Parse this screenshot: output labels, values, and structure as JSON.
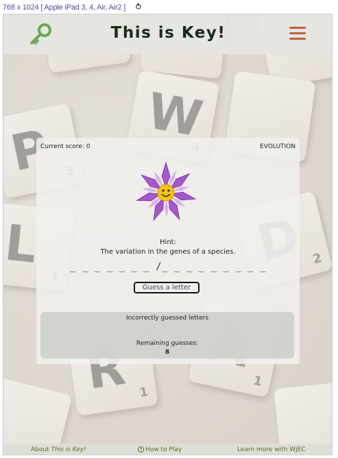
{
  "device": {
    "label": "768 x 1024 [ Apple iPad 3, 4, Air, Air2 ]",
    "rotate_glyph": "⥁"
  },
  "header": {
    "title": "This is Key!",
    "logo_icon": "key-icon",
    "menu_icon": "hamburger-menu-icon",
    "accent": "#c0603a",
    "logo_color": "#6aa84f"
  },
  "background_tiles": [
    {
      "letter": "W",
      "points": "4"
    },
    {
      "letter": "P",
      "points": "3"
    },
    {
      "letter": "L",
      "points": "1"
    },
    {
      "letter": "D",
      "points": "2"
    },
    {
      "letter": "R",
      "points": "1"
    },
    {
      "letter": "A",
      "points": "1"
    }
  ],
  "game": {
    "score_label": "Current score: 0",
    "topic": "EVOLUTION",
    "hint_label": "Hint:",
    "hint_text": "The variation in the genes of a species.",
    "word_blanks": "_ _ _ _ _ _ _ /_ _ _ _ _ _ _ _ _",
    "guess_button_label": "Guess a letter",
    "incorrect_label": "Incorrectly guessed letters",
    "remaining_label": "Remaining guesses:",
    "remaining_count": "8",
    "mascot_icon": "smiling-flower-icon"
  },
  "footer": {
    "about_prefix": "About ",
    "about_em": "This is Key!",
    "howto_icon": "?",
    "howto_label": "How to Play",
    "learn_label": "Learn more with WJEC"
  }
}
